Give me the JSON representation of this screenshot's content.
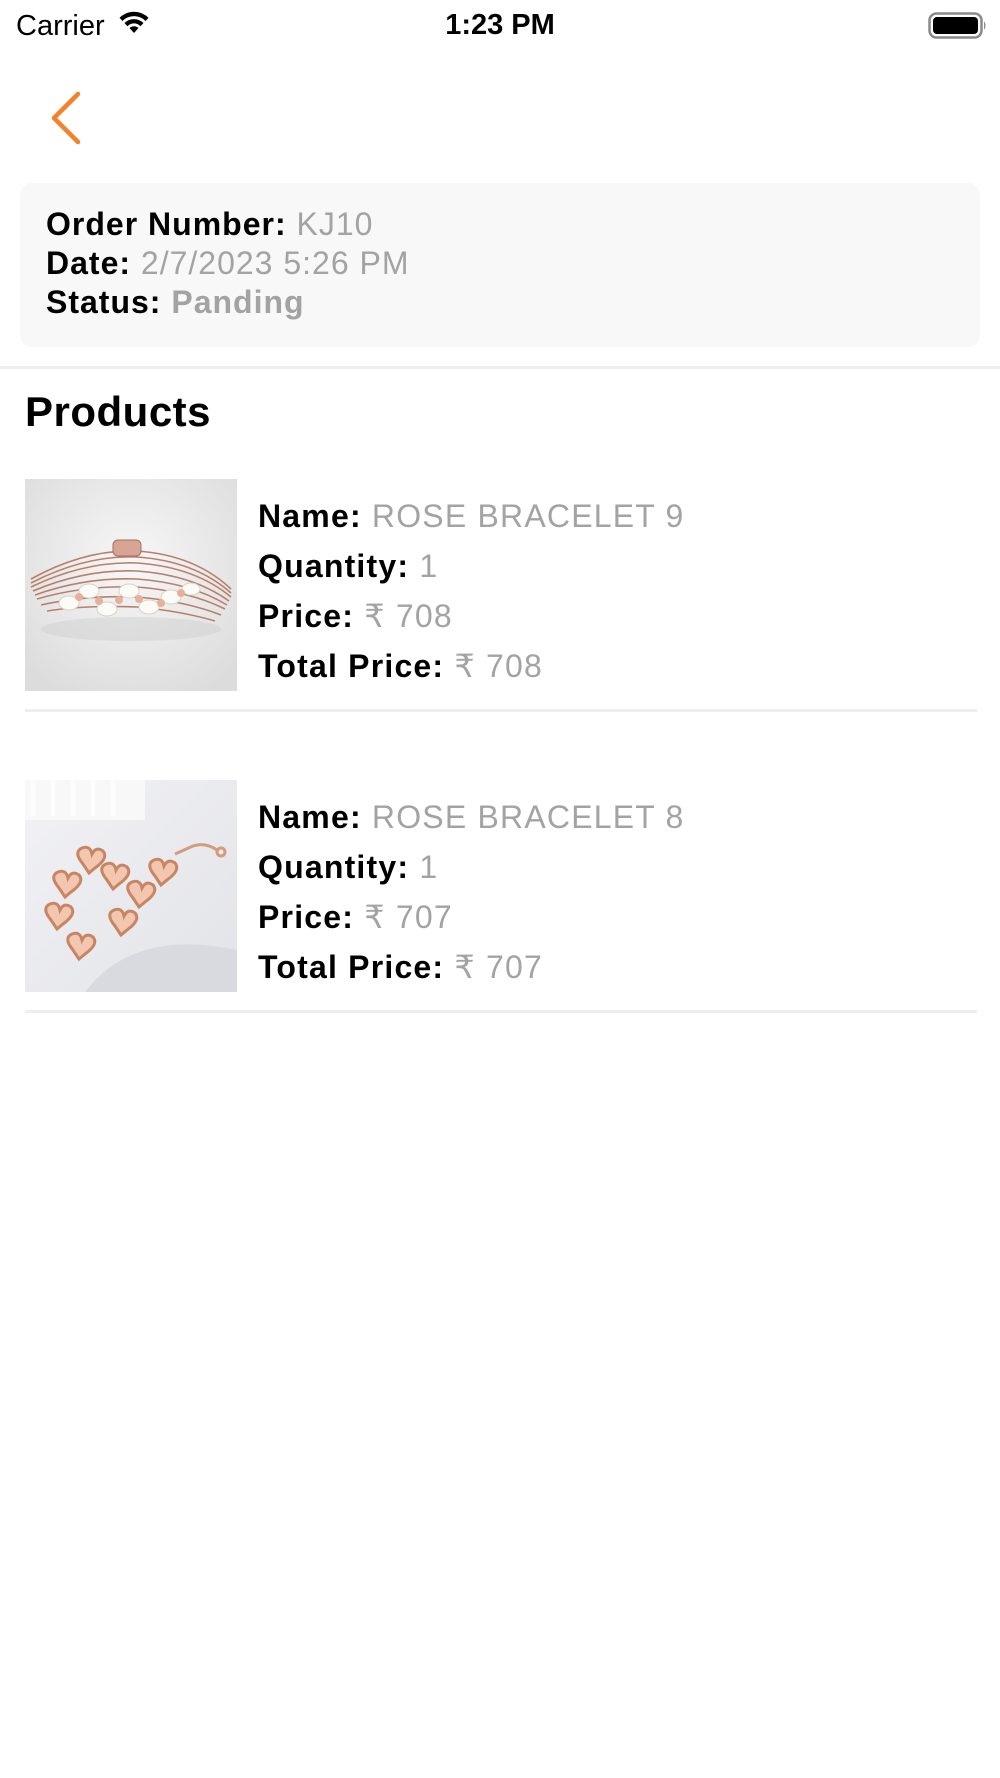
{
  "status_bar": {
    "carrier": "Carrier",
    "time": "1:23 PM"
  },
  "nav": {
    "back_icon": "chevron-left-icon",
    "accent_color": "#f5822a"
  },
  "order": {
    "number_label": "Order Number:",
    "number_value": "KJ10",
    "date_label": "Date:",
    "date_value": "2/7/2023 5:26 PM",
    "status_label": "Status:",
    "status_value": "Panding"
  },
  "products_title": "Products",
  "labels": {
    "name": "Name:",
    "quantity": "Quantity:",
    "price": "Price:",
    "total_price": "Total Price:"
  },
  "products": [
    {
      "name": "ROSE BRACELET 9",
      "quantity": "1",
      "price": "₹ 708",
      "total_price": "₹ 708"
    },
    {
      "name": "ROSE BRACELET 8",
      "quantity": "1",
      "price": "₹ 707",
      "total_price": "₹ 707"
    }
  ]
}
